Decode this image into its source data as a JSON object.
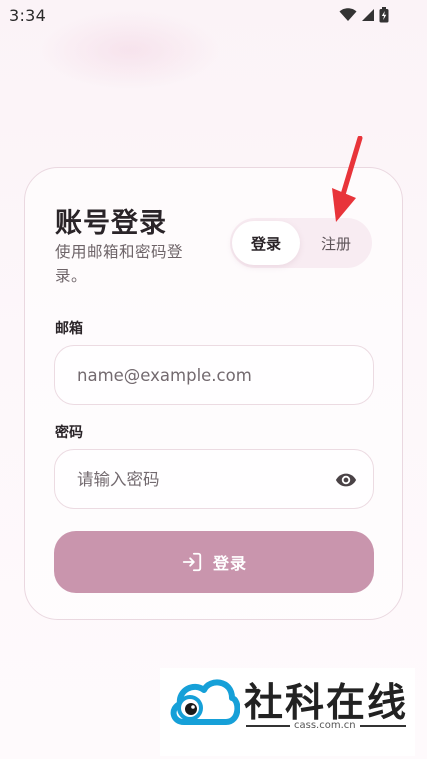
{
  "status_bar": {
    "time": "3:34"
  },
  "card": {
    "title": "账号登录",
    "subtitle": "使用邮箱和密码登录。"
  },
  "tabs": {
    "login": "登录",
    "register": "注册"
  },
  "email": {
    "label": "邮箱",
    "placeholder": "name@example.com"
  },
  "password": {
    "label": "密码",
    "placeholder": "请输入密码"
  },
  "submit": {
    "label": "登录"
  },
  "watermark": {
    "brand": "社科在线",
    "url": "cass.com.cn"
  },
  "colors": {
    "accent": "#c995ad",
    "arrow": "#e8343a",
    "logo_blue": "#16a0d8"
  }
}
